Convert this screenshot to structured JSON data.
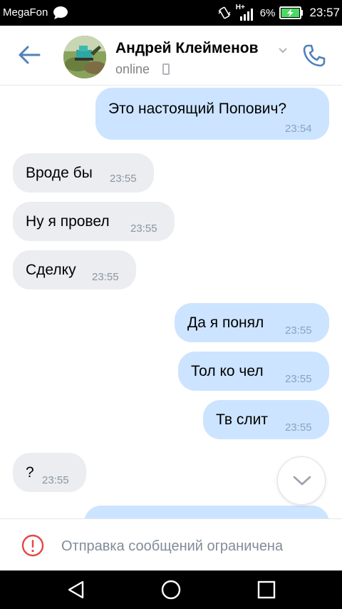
{
  "status_bar": {
    "carrier": "MegaFon",
    "network": "H+",
    "battery": "6%",
    "time": "23:57"
  },
  "header": {
    "contact_name": "Андрей Клейменов",
    "presence": "online",
    "icons": [
      "back-arrow-icon",
      "chevron-down-icon",
      "mobile-phone-icon",
      "phone-call-icon"
    ]
  },
  "messages": [
    {
      "direction": "out",
      "text": "Это настоящий Попович?",
      "time": "23:54"
    },
    {
      "direction": "in",
      "text": "Вроде бы",
      "time": "23:55"
    },
    {
      "direction": "in",
      "text": "Ну я провел",
      "time": "23:55"
    },
    {
      "direction": "in",
      "text": "Сделку",
      "time": "23:55"
    },
    {
      "direction": "out",
      "text": "Да я понял",
      "time": "23:55"
    },
    {
      "direction": "out",
      "text": "Тол ко чел",
      "time": "23:55"
    },
    {
      "direction": "out",
      "text": "Тв слит",
      "time": "23:55"
    },
    {
      "direction": "in",
      "text": "?",
      "time": "23:55"
    }
  ],
  "restriction": {
    "text": "Отправка сообщений ограничена",
    "icon": "warning-circle-icon"
  },
  "colors": {
    "accent": "#5181b8",
    "incoming_bubble": "#ebedf0",
    "outgoing_bubble": "#cce4ff",
    "warning": "#e64646"
  }
}
